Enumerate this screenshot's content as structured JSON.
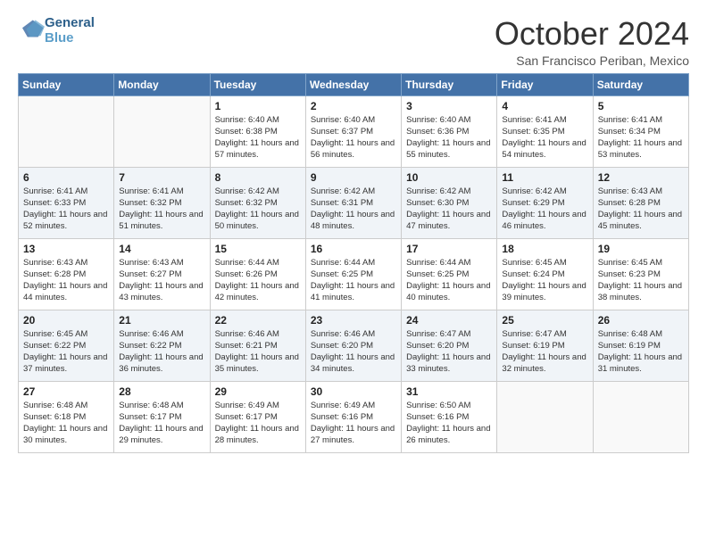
{
  "header": {
    "logo_line1": "General",
    "logo_line2": "Blue",
    "month": "October 2024",
    "location": "San Francisco Periban, Mexico"
  },
  "days_of_week": [
    "Sunday",
    "Monday",
    "Tuesday",
    "Wednesday",
    "Thursday",
    "Friday",
    "Saturday"
  ],
  "weeks": [
    [
      {
        "day": "",
        "detail": ""
      },
      {
        "day": "",
        "detail": ""
      },
      {
        "day": "1",
        "detail": "Sunrise: 6:40 AM\nSunset: 6:38 PM\nDaylight: 11 hours and 57 minutes."
      },
      {
        "day": "2",
        "detail": "Sunrise: 6:40 AM\nSunset: 6:37 PM\nDaylight: 11 hours and 56 minutes."
      },
      {
        "day": "3",
        "detail": "Sunrise: 6:40 AM\nSunset: 6:36 PM\nDaylight: 11 hours and 55 minutes."
      },
      {
        "day": "4",
        "detail": "Sunrise: 6:41 AM\nSunset: 6:35 PM\nDaylight: 11 hours and 54 minutes."
      },
      {
        "day": "5",
        "detail": "Sunrise: 6:41 AM\nSunset: 6:34 PM\nDaylight: 11 hours and 53 minutes."
      }
    ],
    [
      {
        "day": "6",
        "detail": "Sunrise: 6:41 AM\nSunset: 6:33 PM\nDaylight: 11 hours and 52 minutes."
      },
      {
        "day": "7",
        "detail": "Sunrise: 6:41 AM\nSunset: 6:32 PM\nDaylight: 11 hours and 51 minutes."
      },
      {
        "day": "8",
        "detail": "Sunrise: 6:42 AM\nSunset: 6:32 PM\nDaylight: 11 hours and 50 minutes."
      },
      {
        "day": "9",
        "detail": "Sunrise: 6:42 AM\nSunset: 6:31 PM\nDaylight: 11 hours and 48 minutes."
      },
      {
        "day": "10",
        "detail": "Sunrise: 6:42 AM\nSunset: 6:30 PM\nDaylight: 11 hours and 47 minutes."
      },
      {
        "day": "11",
        "detail": "Sunrise: 6:42 AM\nSunset: 6:29 PM\nDaylight: 11 hours and 46 minutes."
      },
      {
        "day": "12",
        "detail": "Sunrise: 6:43 AM\nSunset: 6:28 PM\nDaylight: 11 hours and 45 minutes."
      }
    ],
    [
      {
        "day": "13",
        "detail": "Sunrise: 6:43 AM\nSunset: 6:28 PM\nDaylight: 11 hours and 44 minutes."
      },
      {
        "day": "14",
        "detail": "Sunrise: 6:43 AM\nSunset: 6:27 PM\nDaylight: 11 hours and 43 minutes."
      },
      {
        "day": "15",
        "detail": "Sunrise: 6:44 AM\nSunset: 6:26 PM\nDaylight: 11 hours and 42 minutes."
      },
      {
        "day": "16",
        "detail": "Sunrise: 6:44 AM\nSunset: 6:25 PM\nDaylight: 11 hours and 41 minutes."
      },
      {
        "day": "17",
        "detail": "Sunrise: 6:44 AM\nSunset: 6:25 PM\nDaylight: 11 hours and 40 minutes."
      },
      {
        "day": "18",
        "detail": "Sunrise: 6:45 AM\nSunset: 6:24 PM\nDaylight: 11 hours and 39 minutes."
      },
      {
        "day": "19",
        "detail": "Sunrise: 6:45 AM\nSunset: 6:23 PM\nDaylight: 11 hours and 38 minutes."
      }
    ],
    [
      {
        "day": "20",
        "detail": "Sunrise: 6:45 AM\nSunset: 6:22 PM\nDaylight: 11 hours and 37 minutes."
      },
      {
        "day": "21",
        "detail": "Sunrise: 6:46 AM\nSunset: 6:22 PM\nDaylight: 11 hours and 36 minutes."
      },
      {
        "day": "22",
        "detail": "Sunrise: 6:46 AM\nSunset: 6:21 PM\nDaylight: 11 hours and 35 minutes."
      },
      {
        "day": "23",
        "detail": "Sunrise: 6:46 AM\nSunset: 6:20 PM\nDaylight: 11 hours and 34 minutes."
      },
      {
        "day": "24",
        "detail": "Sunrise: 6:47 AM\nSunset: 6:20 PM\nDaylight: 11 hours and 33 minutes."
      },
      {
        "day": "25",
        "detail": "Sunrise: 6:47 AM\nSunset: 6:19 PM\nDaylight: 11 hours and 32 minutes."
      },
      {
        "day": "26",
        "detail": "Sunrise: 6:48 AM\nSunset: 6:19 PM\nDaylight: 11 hours and 31 minutes."
      }
    ],
    [
      {
        "day": "27",
        "detail": "Sunrise: 6:48 AM\nSunset: 6:18 PM\nDaylight: 11 hours and 30 minutes."
      },
      {
        "day": "28",
        "detail": "Sunrise: 6:48 AM\nSunset: 6:17 PM\nDaylight: 11 hours and 29 minutes."
      },
      {
        "day": "29",
        "detail": "Sunrise: 6:49 AM\nSunset: 6:17 PM\nDaylight: 11 hours and 28 minutes."
      },
      {
        "day": "30",
        "detail": "Sunrise: 6:49 AM\nSunset: 6:16 PM\nDaylight: 11 hours and 27 minutes."
      },
      {
        "day": "31",
        "detail": "Sunrise: 6:50 AM\nSunset: 6:16 PM\nDaylight: 11 hours and 26 minutes."
      },
      {
        "day": "",
        "detail": ""
      },
      {
        "day": "",
        "detail": ""
      }
    ]
  ]
}
